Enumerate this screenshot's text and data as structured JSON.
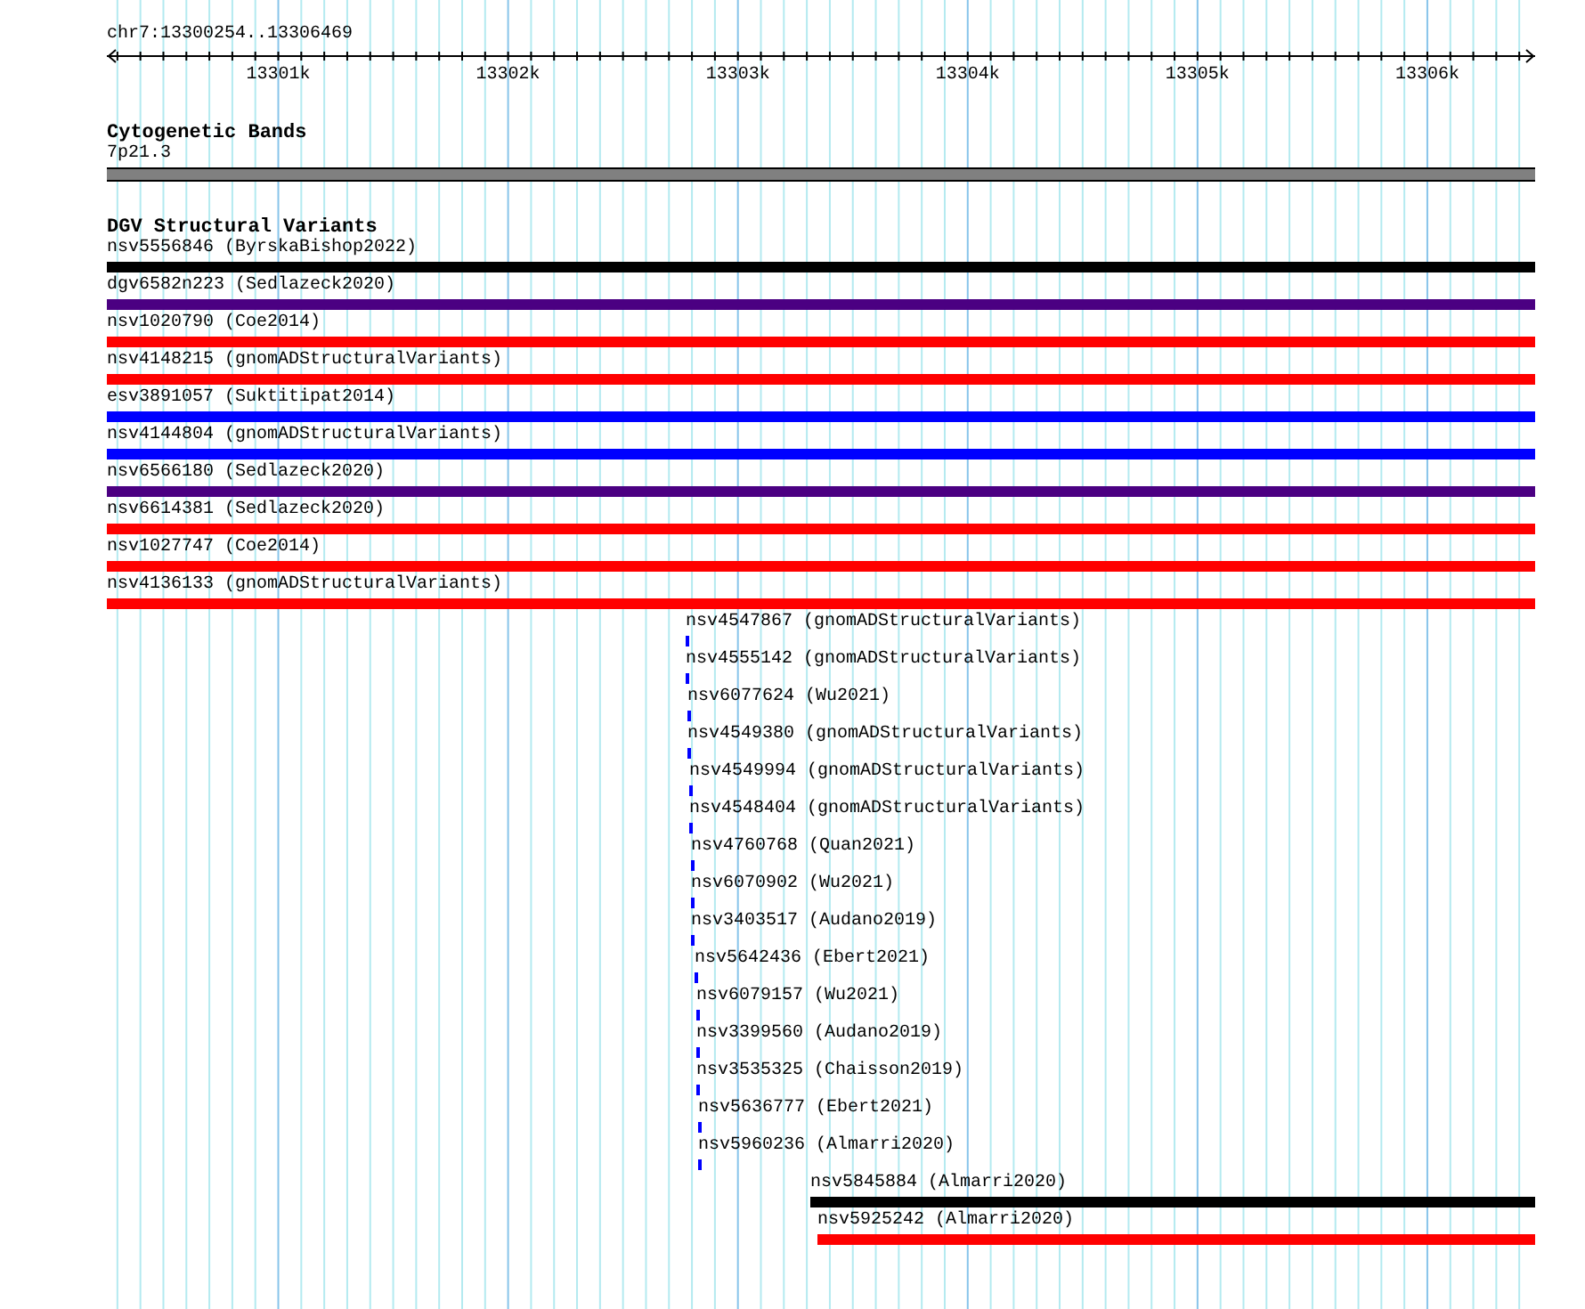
{
  "ruler": {
    "region": "chr7:13300254..13306469",
    "ticks": [
      {
        "label": "13301k"
      },
      {
        "label": "13302k"
      },
      {
        "label": "13303k"
      },
      {
        "label": "13304k"
      },
      {
        "label": "13305k"
      },
      {
        "label": "13306k"
      }
    ]
  },
  "tracks": [
    {
      "title": "Cytogenetic Bands",
      "kind": "bands",
      "features": [
        {
          "label": "7p21.3",
          "color": "#808080"
        }
      ]
    },
    {
      "title": "DGV Structural Variants",
      "kind": "variants",
      "features": [
        {
          "label": "nsv5556846 (ByrskaBishop2022)",
          "color": "#000000"
        },
        {
          "label": "dgv6582n223 (Sedlazeck2020)",
          "color": "#4b0082"
        },
        {
          "label": "nsv1020790 (Coe2014)",
          "color": "#ff0000"
        },
        {
          "label": "nsv4148215 (gnomADStructuralVariants)",
          "color": "#ff0000"
        },
        {
          "label": "esv3891057 (Suktitipat2014)",
          "color": "#0000ff"
        },
        {
          "label": "nsv4144804 (gnomADStructuralVariants)",
          "color": "#0000ff"
        },
        {
          "label": "nsv6566180 (Sedlazeck2020)",
          "color": "#4b0082"
        },
        {
          "label": "nsv6614381 (Sedlazeck2020)",
          "color": "#ff0000"
        },
        {
          "label": "nsv1027747 (Coe2014)",
          "color": "#ff0000"
        },
        {
          "label": "nsv4136133 (gnomADStructuralVariants)",
          "color": "#ff0000"
        },
        {
          "label": "nsv4547867 (gnomADStructuralVariants)",
          "color": "#0000ff"
        },
        {
          "label": "nsv4555142 (gnomADStructuralVariants)",
          "color": "#0000ff"
        },
        {
          "label": "nsv6077624 (Wu2021)",
          "color": "#0000ff"
        },
        {
          "label": "nsv4549380 (gnomADStructuralVariants)",
          "color": "#0000ff"
        },
        {
          "label": "nsv4549994 (gnomADStructuralVariants)",
          "color": "#0000ff"
        },
        {
          "label": "nsv4548404 (gnomADStructuralVariants)",
          "color": "#0000ff"
        },
        {
          "label": "nsv4760768 (Quan2021)",
          "color": "#0000ff"
        },
        {
          "label": "nsv6070902 (Wu2021)",
          "color": "#0000ff"
        },
        {
          "label": "nsv3403517 (Audano2019)",
          "color": "#0000ff"
        },
        {
          "label": "nsv5642436 (Ebert2021)",
          "color": "#0000ff"
        },
        {
          "label": "nsv6079157 (Wu2021)",
          "color": "#0000ff"
        },
        {
          "label": "nsv3399560 (Audano2019)",
          "color": "#0000ff"
        },
        {
          "label": "nsv3535325 (Chaisson2019)",
          "color": "#0000ff"
        },
        {
          "label": "nsv5636777 (Ebert2021)",
          "color": "#0000ff"
        },
        {
          "label": "nsv5960236 (Almarri2020)",
          "color": "#0000ff"
        },
        {
          "label": "nsv5845884 (Almarri2020)",
          "color": "#000000"
        },
        {
          "label": "nsv5925242 (Almarri2020)",
          "color": "#ff0000"
        }
      ]
    }
  ]
}
